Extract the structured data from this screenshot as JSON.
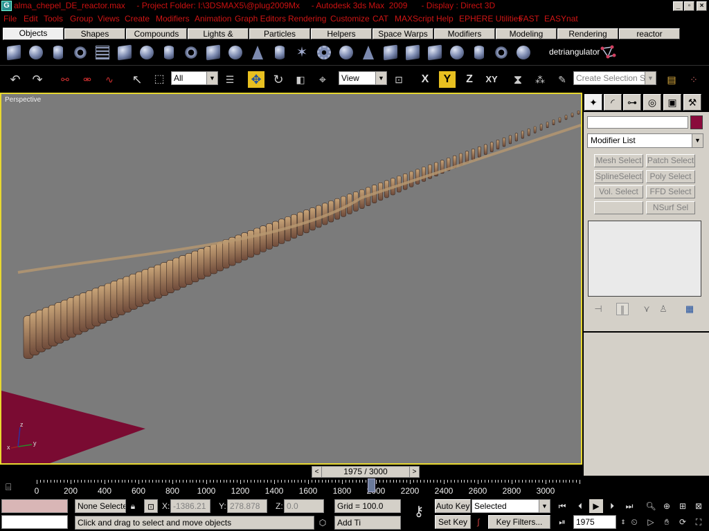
{
  "titlebar": {
    "title": "alma_chepel_DE_reactor.max     - Project Folder: I:\\3DSMAX5\\@plug2009Mx     - Autodesk 3ds Max  2009      - Display : Direct 3D",
    "minimize_glyph": "_",
    "restore_glyph": "▫",
    "close_glyph": "×"
  },
  "menu": {
    "items": [
      "File",
      "Edit",
      "Tools",
      "Group",
      "Views",
      "Create",
      "Modifiers",
      "Animation",
      "Graph Editors",
      "Rendering",
      "Customize",
      "CAT",
      "MAXScript",
      "Help",
      "EPHERE Utilities",
      "FAST",
      "EASYnat"
    ]
  },
  "tabs": {
    "items": [
      "Objects",
      "Shapes",
      "Compounds",
      "Lights & Cameras",
      "Particles",
      "Helpers",
      "Space Warps",
      "Modifiers",
      "Modeling",
      "Rendering",
      "reactor"
    ]
  },
  "objects_toolbar": {
    "detriangulator_label": "detriangulator"
  },
  "main_toolbar": {
    "selection_filter": "All",
    "ref_coord": "View",
    "named_selection_placeholder": "Create Selection Set",
    "axis_x": "X",
    "axis_y": "Y",
    "axis_z": "Z",
    "axis_xy": "XY"
  },
  "viewport": {
    "label": "Perspective",
    "axis_x": "x",
    "axis_y": "y",
    "axis_z": "z"
  },
  "command_panel": {
    "object_color": "#8a0b3c",
    "modifier_list": "Modifier List",
    "modifier_buttons": [
      "Mesh Select",
      "Patch Select",
      "SplineSelect",
      "Poly Select",
      "Vol. Select",
      "FFD Select",
      "",
      "NSurf Sel"
    ]
  },
  "time_slider": {
    "frame_label": "1975 / 3000"
  },
  "trackbar": {
    "ticks": [
      "0",
      "200",
      "400",
      "600",
      "800",
      "1000",
      "1200",
      "1400",
      "1600",
      "1800",
      "2000",
      "2200",
      "2400",
      "2600",
      "2800",
      "3000"
    ]
  },
  "status": {
    "selection": "None Selecte",
    "x_label": "X:",
    "x_value": "-1386.21",
    "y_label": "Y:",
    "y_value": "278.878",
    "z_label": "Z:",
    "z_value": "0.0",
    "grid": "Grid = 100.0",
    "prompt": "Click and drag to select and move objects",
    "add_time_tag": "Add Ti",
    "auto_key": "Auto Key",
    "set_key": "Set Key",
    "key_mode": "Selected",
    "key_filters": "Key Filters...",
    "current_frame": "1975"
  }
}
